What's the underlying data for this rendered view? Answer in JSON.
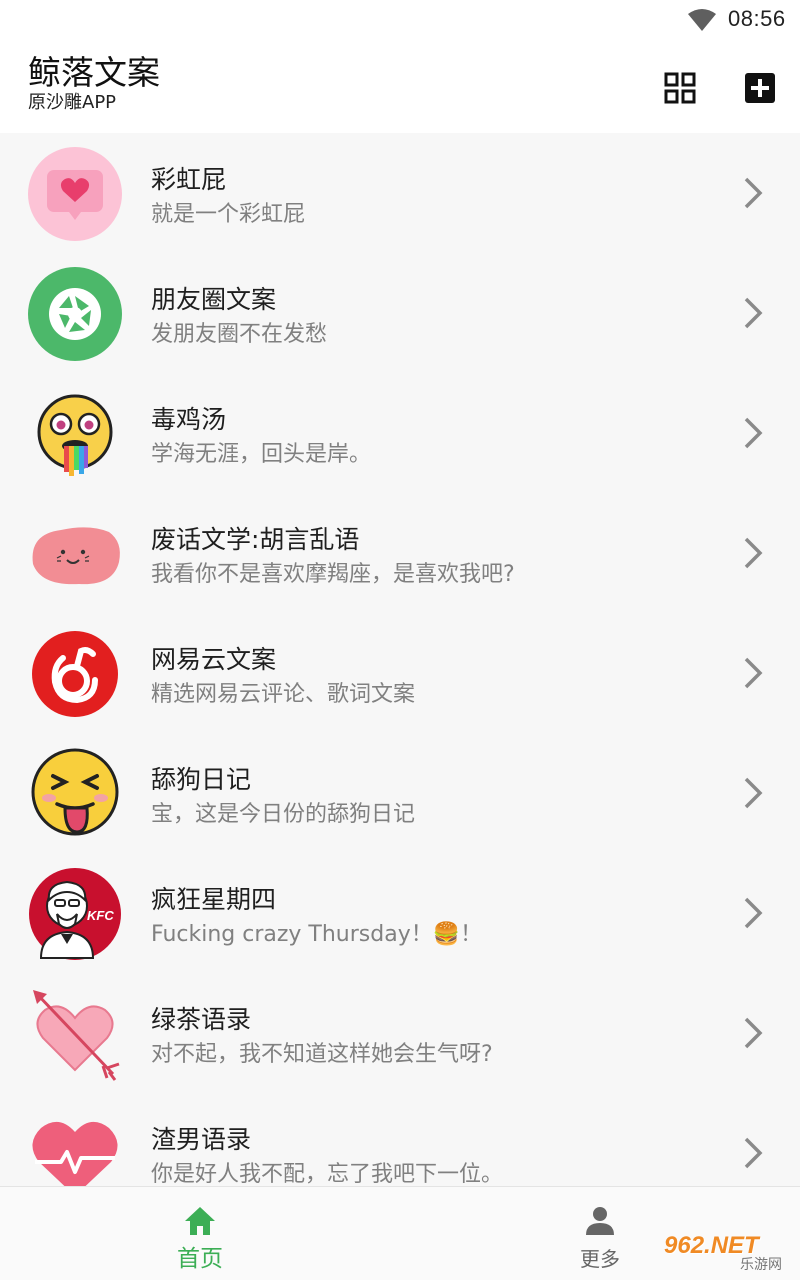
{
  "status_bar": {
    "time": "08:56"
  },
  "app_bar": {
    "title": "鲸落文案",
    "subtitle": "原沙雕APP"
  },
  "list": [
    {
      "title": "彩虹屁",
      "subtitle": "就是一个彩虹屁",
      "icon": "pink-heart-chat-icon"
    },
    {
      "title": "朋友圈文案",
      "subtitle": "发朋友圈不在发愁",
      "icon": "camera-aperture-icon"
    },
    {
      "title": "毒鸡汤",
      "subtitle": "学海无涯，回头是岸。",
      "icon": "rainbow-puke-emoji-icon"
    },
    {
      "title": "废话文学:胡言乱语",
      "subtitle": "我看你不是喜欢摩羯座，是喜欢我吧?",
      "icon": "pink-blob-face-icon"
    },
    {
      "title": "网易云文案",
      "subtitle": "精选网易云评论、歌词文案",
      "icon": "netease-music-icon"
    },
    {
      "title": "舔狗日记",
      "subtitle": "宝，这是今日份的舔狗日记",
      "icon": "tongue-out-emoji-icon"
    },
    {
      "title": "疯狂星期四",
      "subtitle": "Fucking crazy Thursday！🍔！",
      "icon": "kfc-logo-icon"
    },
    {
      "title": "绿茶语录",
      "subtitle": "对不起，我不知道这样她会生气呀?",
      "icon": "heart-arrow-icon"
    },
    {
      "title": "渣男语录",
      "subtitle": "你是好人我不配，忘了我吧下一位。",
      "icon": "heartbeat-heart-icon"
    }
  ],
  "bottom_nav": {
    "home": "首页",
    "more": "更多"
  },
  "watermark": {
    "number": "962.NET",
    "site": "乐游网"
  },
  "colors": {
    "accent": "#3cae55",
    "chevron": "#8a8a8a"
  }
}
